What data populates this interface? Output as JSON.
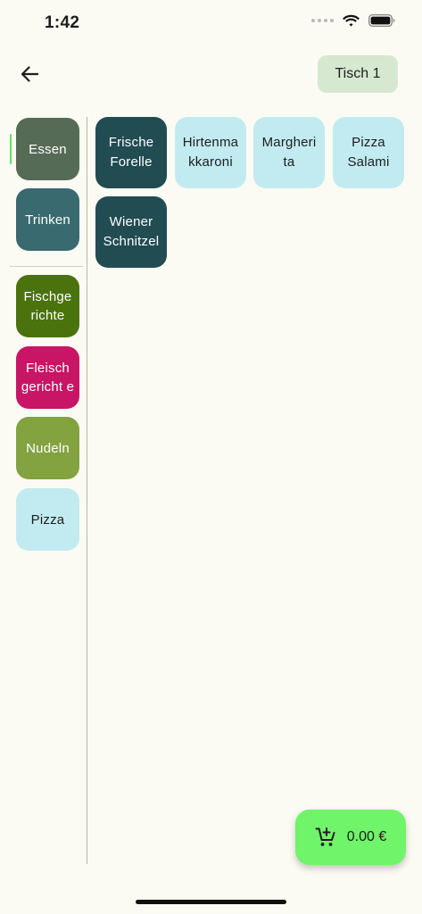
{
  "status_bar": {
    "time": "1:42"
  },
  "header": {
    "table_label": "Tisch 1"
  },
  "colors": {
    "background": "#fbfbf3",
    "cart_accent": "#6ff46a",
    "active_indicator": "#5fe25f"
  },
  "main_categories": [
    {
      "label": "Essen",
      "color": "#566b55",
      "active": true
    },
    {
      "label": "Trinken",
      "color": "#386a70"
    }
  ],
  "sub_categories": [
    {
      "label": "Fischge richte",
      "color": "#4a730e"
    },
    {
      "label": "Fleisch gericht e",
      "color": "#c81565"
    },
    {
      "label": "Nudeln",
      "color": "#83a240"
    },
    {
      "label": "Pizza",
      "color": "#c1ebf1"
    }
  ],
  "products": [
    {
      "label": "Frische Forelle"
    },
    {
      "label": "Hirtenma kkaroni"
    },
    {
      "label": "Margheri ta"
    },
    {
      "label": "Pizza Salami"
    },
    {
      "label": "Wiener Schnitzel"
    }
  ],
  "cart": {
    "total": "0.00 €"
  },
  "icons": {
    "back": "arrow-left-icon",
    "cart": "add-shopping-cart-icon"
  }
}
